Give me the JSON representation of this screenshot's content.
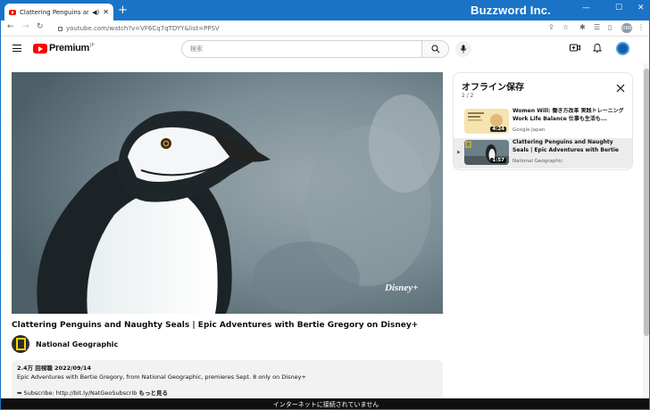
{
  "browser": {
    "tab_title": "Clattering Penguins and Na",
    "new_tab": "+",
    "brand_watermark": "Buzzword Inc.",
    "url": "youtube.com/watch?v=VF6Cq7qTDYY&list=PPSV",
    "profile_chip": "ORB"
  },
  "youtube": {
    "logo_text": "Premium",
    "logo_region": "JP",
    "search_placeholder": "検索"
  },
  "video": {
    "watermark": "Disney+",
    "title": "Clattering Penguins and Naughty Seals | Epic Adventures with Bertie Gregory on Disney+",
    "channel": "National Geographic",
    "stats": "2.4万 回視聴  2022/09/14",
    "description_line1": "Epic Adventures with Bertie Gregory, from National Geographic, premieres Sept. 8 only on Disney+",
    "description_line2": "➡ Subscribe: http://bit.ly/NatGeoSubscrib",
    "more_label": "もっと見る"
  },
  "panel": {
    "title": "オフライン保存",
    "count": "2 / 2",
    "items": [
      {
        "title": "Women Will: 働き方改革 実践トレーニング Work Life Balance 仕事も生活も...",
        "channel": "Google Japan",
        "duration": "4:24",
        "marker": ""
      },
      {
        "title": "Clattering Penguins and Naughty Seals | Epic Adventures with Bertie Gregory o...",
        "channel": "National Geographic",
        "duration": "1:57",
        "marker": "▶"
      }
    ]
  },
  "status": {
    "offline_message": "インターネットに接続されていません"
  },
  "colors": {
    "titlebar": "#1a73c7",
    "youtube_red": "#ff0000",
    "active_item": "#ececec"
  }
}
